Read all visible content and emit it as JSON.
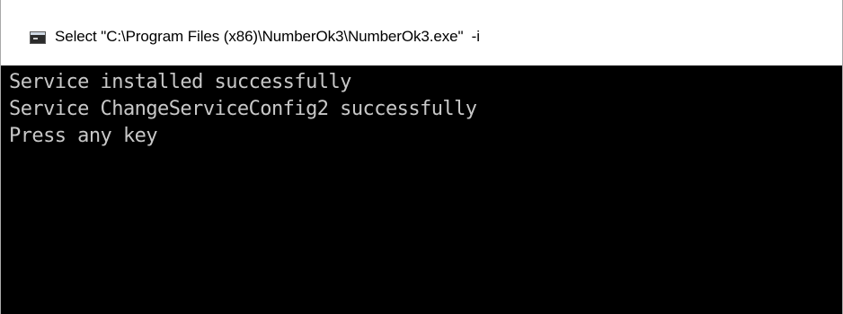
{
  "window": {
    "title": "Select \"C:\\Program Files (x86)\\NumberOk3\\NumberOk3.exe\"  -i",
    "icon": "console-window-icon"
  },
  "console": {
    "lines": [
      "Service installed successfully",
      "Service ChangeServiceConfig2 successfully",
      "Press any key"
    ]
  },
  "colors": {
    "console_background": "#000000",
    "console_text": "#c8c8c8",
    "titlebar_background": "#ffffff"
  }
}
